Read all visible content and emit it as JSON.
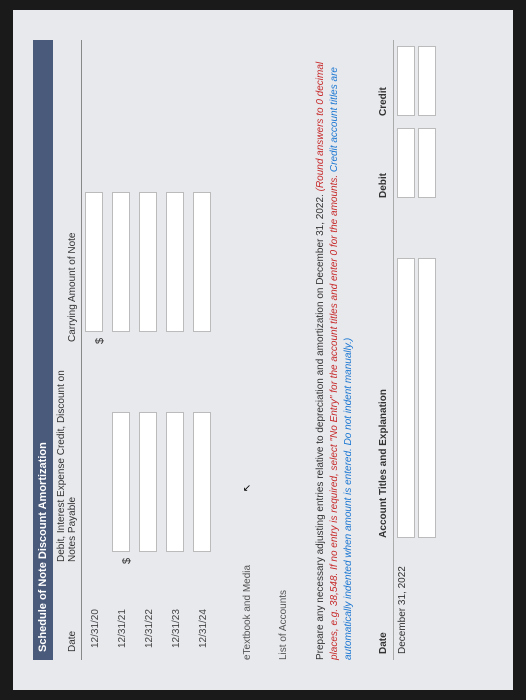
{
  "schedule": {
    "title": "Schedule of Note Discount Amortization",
    "columns": {
      "date": "Date",
      "expense": "Debit, Interest Expense Credit, Discount on Notes Payable",
      "carrying": "Carrying Amount of Note"
    },
    "rows": [
      "12/31/20",
      "12/31/21",
      "12/31/22",
      "12/31/23",
      "12/31/24"
    ],
    "currency": "$"
  },
  "links": {
    "etext": "eTextbook and Media",
    "loa": "List of Accounts"
  },
  "instruction": {
    "plain": "Prepare any necessary adjusting entries relative to depreciation and amortization on December 31, 2022. ",
    "red1": "(Round answers to 0 decimal places, e.g. 38,548. If no entry is required, select \"No Entry\" for the account titles and enter 0 for the amounts. ",
    "blue": "Credit account titles are automatically indented when amount is entered. Do not indent manually.)",
    "red2": ""
  },
  "journal": {
    "headers": {
      "date": "Date",
      "titles": "Account Titles and Explanation",
      "debit": "Debit",
      "credit": "Credit"
    },
    "date": "December 31, 2022"
  }
}
